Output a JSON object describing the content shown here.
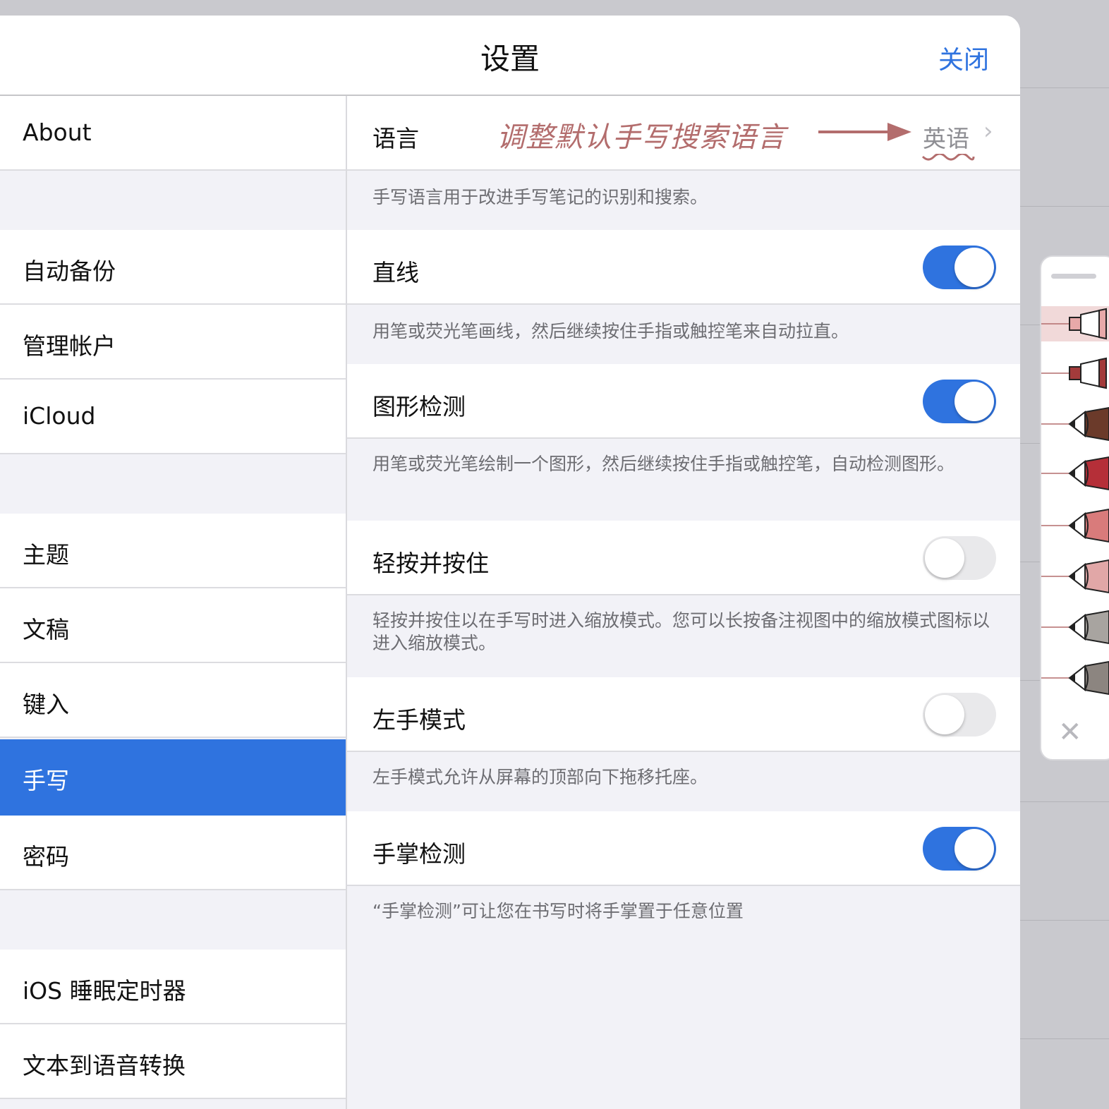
{
  "nav": {
    "title": "设置",
    "close_label": "关闭"
  },
  "sidebar": {
    "items": [
      {
        "label": "About"
      },
      {
        "label": "自动备份"
      },
      {
        "label": "管理帐户"
      },
      {
        "label": "iCloud"
      },
      {
        "label": "主题"
      },
      {
        "label": "文稿"
      },
      {
        "label": "键入"
      },
      {
        "label": "手写",
        "selected": true
      },
      {
        "label": "密码"
      },
      {
        "label": "iOS 睡眠定时器"
      },
      {
        "label": "文本到语音转换"
      }
    ]
  },
  "settings": {
    "language": {
      "label": "语言",
      "value": "英语",
      "annotation": "调整默认手写搜索语言",
      "desc": "手写语言用于改进手写笔记的识别和搜索。"
    },
    "straight_line": {
      "label": "直线",
      "on": true,
      "desc": "用笔或荧光笔画线，然后继续按住手指或触控笔来自动拉直。"
    },
    "shape_detection": {
      "label": "图形检测",
      "on": true,
      "desc": "用笔或荧光笔绘制一个图形，然后继续按住手指或触控笔，自动检测图形。"
    },
    "tap_hold": {
      "label": "轻按并按住",
      "on": false,
      "desc": "轻按并按住以在手写时进入缩放模式。您可以长按备注视图中的缩放模式图标以进入缩放模式。"
    },
    "left_hand": {
      "label": "左手模式",
      "on": false,
      "desc": "左手模式允许从屏幕的顶部向下拖移托座。"
    },
    "palm_detection": {
      "label": "手掌检测",
      "on": true,
      "desc": "“手掌检测”可让您在书写时将手掌置于任意位置"
    }
  },
  "colors": {
    "accent": "#2f73df",
    "annotation": "#b36d6d",
    "pen_colors": [
      "#e7a9a9",
      "#a33b3b",
      "#6b3a2a",
      "#b52f38",
      "#d97b7b",
      "#e1a7a7",
      "#a8a4a0",
      "#8c8580"
    ]
  },
  "icons": [
    "chevron-right-icon",
    "arrow-right-icon",
    "close-icon",
    "pen-icon"
  ]
}
